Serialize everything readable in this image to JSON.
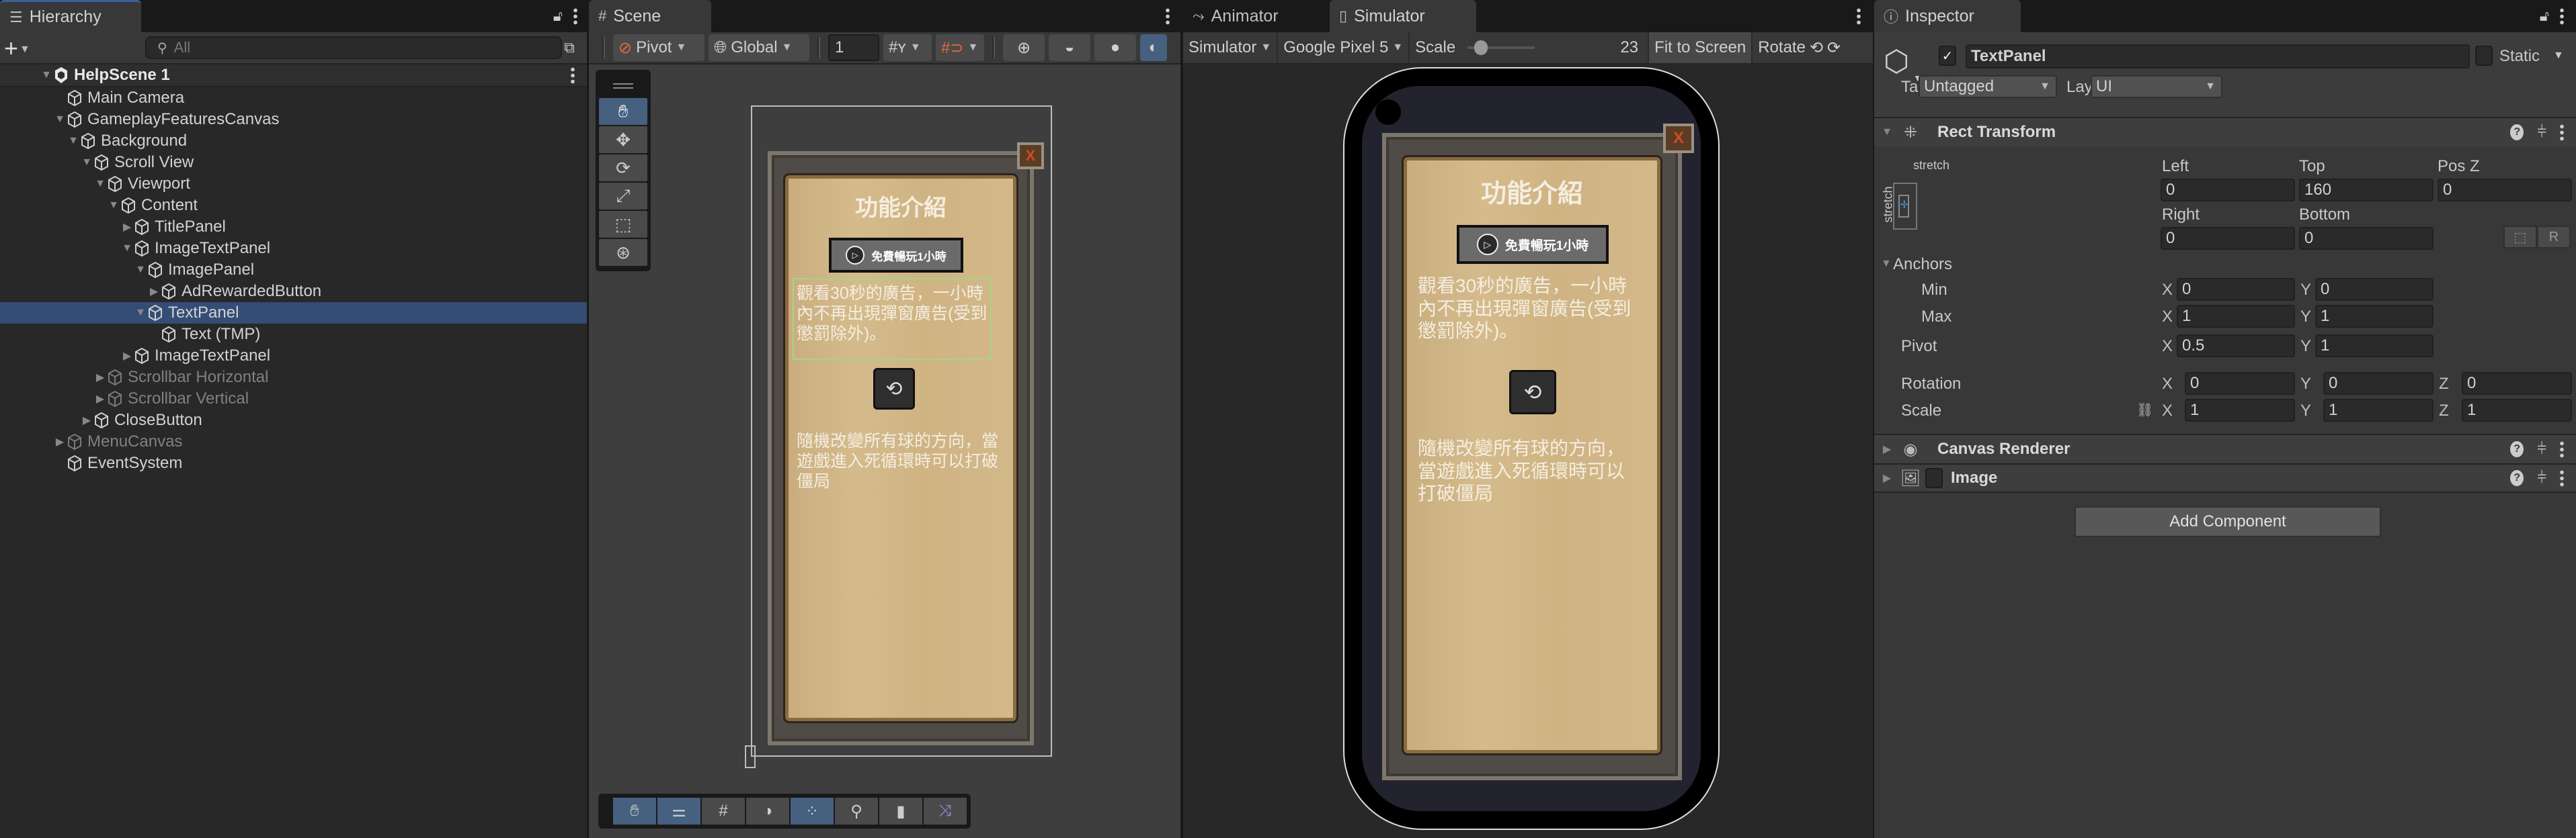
{
  "hierarchy": {
    "tab_label": "Hierarchy",
    "search_placeholder": "All",
    "scene_name": "HelpScene 1",
    "items": [
      {
        "label": "Main Camera",
        "depth": 1,
        "arrow": "none",
        "state": "normal"
      },
      {
        "label": "GameplayFeaturesCanvas",
        "depth": 1,
        "arrow": "expanded",
        "state": "normal"
      },
      {
        "label": "Background",
        "depth": 2,
        "arrow": "expanded",
        "state": "normal"
      },
      {
        "label": "Scroll View",
        "depth": 3,
        "arrow": "expanded",
        "state": "normal"
      },
      {
        "label": "Viewport",
        "depth": 4,
        "arrow": "expanded",
        "state": "normal"
      },
      {
        "label": "Content",
        "depth": 5,
        "arrow": "expanded",
        "state": "normal"
      },
      {
        "label": "TitlePanel",
        "depth": 6,
        "arrow": "collapsed",
        "state": "normal"
      },
      {
        "label": "ImageTextPanel",
        "depth": 6,
        "arrow": "expanded",
        "state": "normal"
      },
      {
        "label": "ImagePanel",
        "depth": 7,
        "arrow": "expanded",
        "state": "normal"
      },
      {
        "label": "AdRewardedButton",
        "depth": 8,
        "arrow": "collapsed",
        "state": "normal"
      },
      {
        "label": "TextPanel",
        "depth": 7,
        "arrow": "expanded",
        "state": "selected"
      },
      {
        "label": "Text (TMP)",
        "depth": 8,
        "arrow": "none",
        "state": "normal"
      },
      {
        "label": "ImageTextPanel",
        "depth": 6,
        "arrow": "collapsed",
        "state": "normal"
      },
      {
        "label": "Scrollbar Horizontal",
        "depth": 4,
        "arrow": "collapsed",
        "state": "disabled"
      },
      {
        "label": "Scrollbar Vertical",
        "depth": 4,
        "arrow": "collapsed",
        "state": "disabled"
      },
      {
        "label": "CloseButton",
        "depth": 3,
        "arrow": "collapsed",
        "state": "normal"
      },
      {
        "label": "MenuCanvas",
        "depth": 1,
        "arrow": "collapsed",
        "state": "disabled"
      },
      {
        "label": "EventSystem",
        "depth": 1,
        "arrow": "none",
        "state": "normal"
      }
    ]
  },
  "scene": {
    "tab_label": "Scene",
    "pivot_label": "Pivot",
    "global_label": "Global",
    "grid_value": "1",
    "tools": [
      "hand-tool",
      "move-tool",
      "rotate-tool",
      "scale-tool",
      "rect-tool",
      "transform-tool"
    ],
    "active_tool": "hand-tool",
    "overlays": [
      "hand",
      "tool-settings",
      "grid-snapping",
      "shading",
      "components",
      "search",
      "camera",
      "nav"
    ]
  },
  "game_ui": {
    "title": "功能介紹",
    "ad_button_label": "免費暢玩1小時",
    "paragraph1": "觀看30秒的廣告，一小時內不再出現彈窗廣告(受到懲罰除外)。",
    "paragraph2": "隨機改變所有球的方向，當遊戲進入死循環時可以打破僵局",
    "close_glyph": "X"
  },
  "simulator": {
    "tab_animator": "Animator",
    "tab_simulator": "Simulator",
    "mode": "Simulator",
    "device": "Google Pixel 5",
    "scale_label": "Scale",
    "scale_value": "23",
    "fit_label": "Fit to Screen",
    "rotate_label": "Rotate"
  },
  "inspector": {
    "tab_label": "Inspector",
    "object_name": "TextPanel",
    "active": true,
    "static_label": "Static",
    "tag_label": "Tag",
    "tag_value": "Untagged",
    "layer_label": "Layer",
    "layer_value": "UI",
    "rect_transform": {
      "title": "Rect Transform",
      "anchor_preset_h": "stretch",
      "anchor_preset_v": "stretch",
      "left_label": "Left",
      "left": "0",
      "top_label": "Top",
      "top": "160",
      "posz_label": "Pos Z",
      "posz": "0",
      "right_label": "Right",
      "right": "0",
      "bottom_label": "Bottom",
      "bottom": "0",
      "anchors_label": "Anchors",
      "min_label": "Min",
      "min_x": "0",
      "min_y": "0",
      "max_label": "Max",
      "max_x": "1",
      "max_y": "1",
      "pivot_label": "Pivot",
      "pivot_x": "0.5",
      "pivot_y": "1",
      "rotation_label": "Rotation",
      "rot_x": "0",
      "rot_y": "0",
      "rot_z": "0",
      "scale_label": "Scale",
      "scale_x": "1",
      "scale_y": "1",
      "scale_z": "1",
      "raw_edit_label": "R"
    },
    "components": [
      {
        "title": "Canvas Renderer"
      },
      {
        "title": "Image"
      }
    ],
    "add_component_label": "Add Component"
  }
}
